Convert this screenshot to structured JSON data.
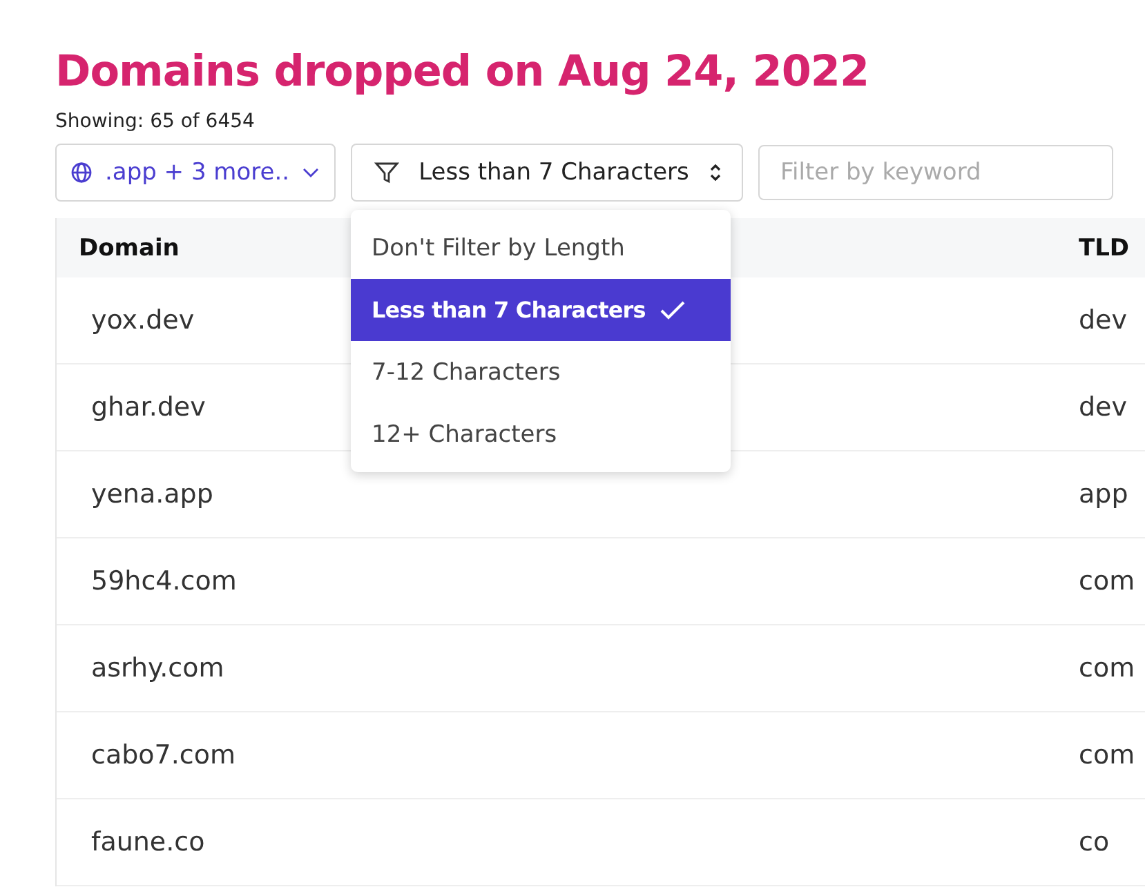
{
  "title": "Domains dropped on Aug 24, 2022",
  "showing": "Showing: 65 of 6454",
  "filters": {
    "tld_button": ".app + 3 more..",
    "length_select": "Less than 7 Characters",
    "keyword": {
      "placeholder": "Filter by keyword"
    }
  },
  "length_menu": [
    {
      "label": "Don't Filter by Length",
      "selected": false
    },
    {
      "label": "Less than 7 Characters",
      "selected": true
    },
    {
      "label": "7-12 Characters",
      "selected": false
    },
    {
      "label": "12+ Characters",
      "selected": false
    }
  ],
  "table": {
    "columns": [
      "Domain",
      "TLD"
    ],
    "rows": [
      [
        "yox.dev",
        "dev"
      ],
      [
        "ghar.dev",
        "dev"
      ],
      [
        "yena.app",
        "app"
      ],
      [
        "59hc4.com",
        "com"
      ],
      [
        "asrhy.com",
        "com"
      ],
      [
        "cabo7.com",
        "com"
      ],
      [
        "faune.co",
        "co"
      ]
    ]
  }
}
